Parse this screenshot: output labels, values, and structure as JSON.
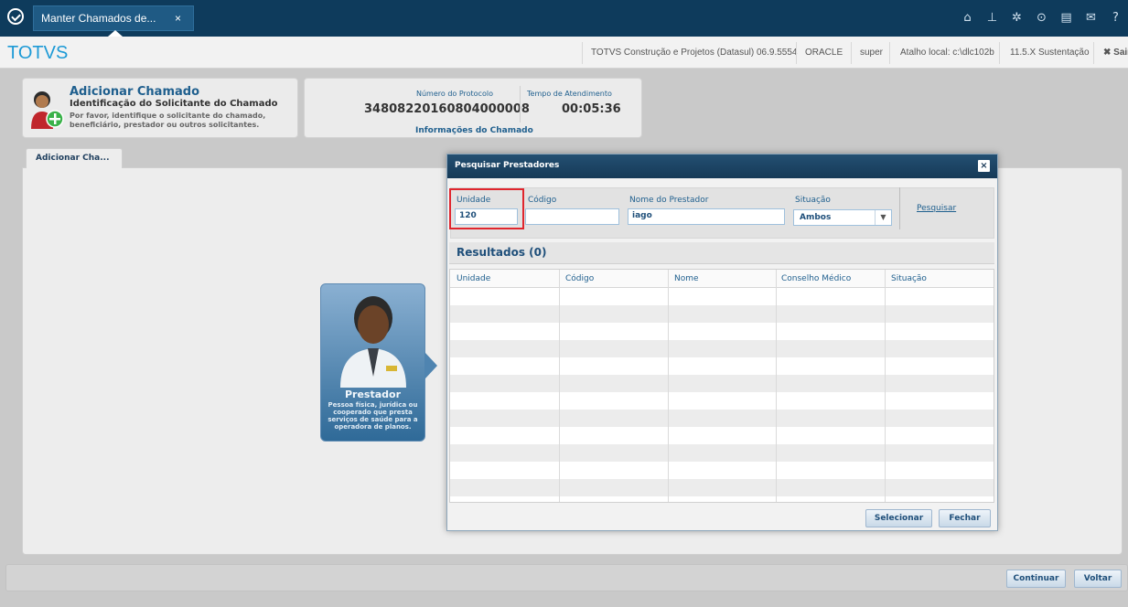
{
  "colors": {
    "topbar": "#0e3b5c",
    "brand": "#1d9ad6",
    "link": "#1f5f8e",
    "highlight": "#e0262e"
  },
  "topbar": {
    "tab_label": "Manter Chamados de...",
    "tab_close": "×",
    "icons": [
      "home-icon",
      "sitemap-icon",
      "gear-icon",
      "clock-icon",
      "document-icon",
      "mail-icon",
      "help-icon"
    ]
  },
  "subbar": {
    "brand": "TOTVS",
    "product": "TOTVS Construção e Projetos (Datasul) 06.9.5554",
    "db": "ORACLE",
    "user": "super",
    "atalho": "Atalho local: c:\\dlc102b",
    "version": "11.5.X Sustentação",
    "exit": "✖ Sair"
  },
  "header": {
    "title": "Adicionar Chamado",
    "subtitle": "Identificação do Solicitante do Chamado",
    "description": "Por favor, identifique o solicitante do chamado, beneficiário, prestador ou outros solicitantes."
  },
  "protocol": {
    "number_label": "Número do Protocolo",
    "number_value": "34808220160804000008",
    "time_label": "Tempo de Atendimento",
    "time_value": "00:05:36",
    "footer": "Informações do Chamado"
  },
  "tabs": {
    "active": "Adicionar Cha..."
  },
  "prestador_card": {
    "title": "Prestador",
    "description": "Pessoa física, jurídica ou cooperado que presta serviços de saúde para a operadora de planos."
  },
  "modal": {
    "title": "Pesquisar Prestadores",
    "close": "×",
    "filters": {
      "unidade_label": "Unidade",
      "unidade_value": "120",
      "codigo_label": "Código",
      "codigo_value": "",
      "nome_label": "Nome do Prestador",
      "nome_value": "iago",
      "situacao_label": "Situação",
      "situacao_value": "Ambos",
      "search_link": "Pesquisar"
    },
    "results_title": "Resultados (0)",
    "columns": [
      "Unidade",
      "Código",
      "Nome",
      "Conselho Médico",
      "Situação"
    ],
    "rows": [],
    "select_button": "Selecionar",
    "close_button": "Fechar"
  },
  "footer": {
    "continue": "Continuar",
    "back": "Voltar"
  }
}
